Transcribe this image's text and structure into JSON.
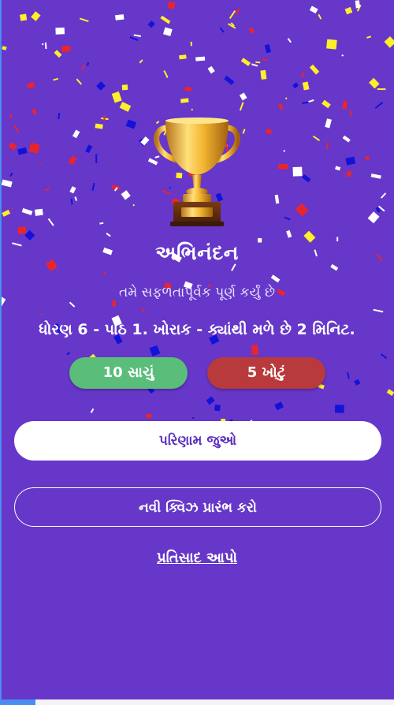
{
  "result": {
    "title": "અભિનંદન",
    "subtitle": "તમે સફળતાપૂર્વક પૂર્ણ કર્યું છે",
    "lesson": "ધોરણ 6 - પાઠ 1. ખોરાક - ક્યાંથી મળે છે 2 મિનિટ.",
    "correct_label": "10 સાચું",
    "wrong_label": "5 ખોટું"
  },
  "scores": {
    "correct": 10,
    "wrong": 5
  },
  "actions": {
    "view_results": "પરિણામ જુઓ",
    "new_quiz": "નવી ક્વિઝ પ્રારંભ કરો",
    "feedback": "પ્રતિસાદ આપો"
  },
  "colors": {
    "background": "#6637c9",
    "correct": "#5bbd7a",
    "wrong": "#b93a3c",
    "primary_text": "#5a2fbf",
    "confetti": [
      "#ffffff",
      "#ffef2b",
      "#e8252e",
      "#1212d9"
    ]
  },
  "icons": {
    "trophy": "trophy-icon"
  }
}
